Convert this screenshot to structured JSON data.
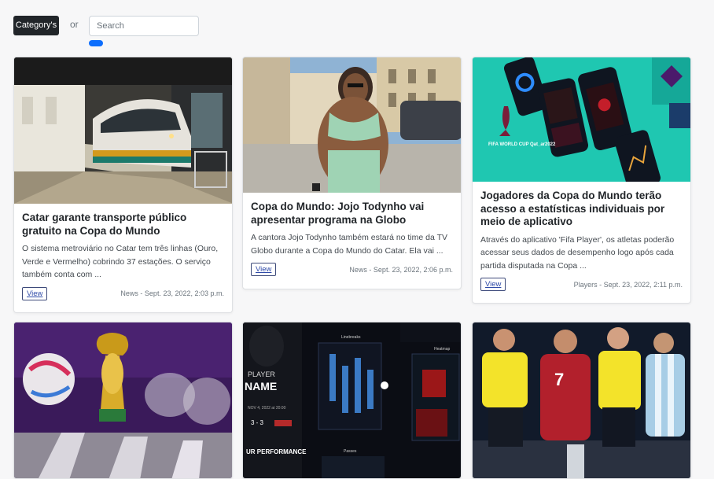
{
  "toolbar": {
    "category_label": "Category's",
    "or_label": "or",
    "search_placeholder": "Search"
  },
  "cards": [
    {
      "title": "Catar garante transporte público gratuito na Copa do Mundo",
      "excerpt": "O sistema metroviário no Catar tem três linhas (Ouro, Verde e Vermelho) cobrindo 37 estações. O serviço também conta com ...",
      "view_label": "View",
      "meta": "News - Sept. 23, 2022, 2:03 p.m.",
      "image": "metro-train-photo"
    },
    {
      "title": "Copa do Mundo: Jojo Todynho vai apresentar programa na Globo",
      "excerpt": "A cantora Jojo Todynho também estará no time da TV Globo durante a Copa do Mundo do Catar. Ela vai ...",
      "view_label": "View",
      "meta": "News - Sept. 23, 2022, 2:06 p.m.",
      "image": "street-portrait-photo"
    },
    {
      "title": "Jogadores da Copa do Mundo terão acesso a estatísticas individuais por meio de aplicativo",
      "excerpt": "Através do aplicativo 'Fifa Player', os atletas poderão acessar seus dados de desempenho logo após cada partida disputada na Copa ...",
      "view_label": "View",
      "meta": "Players - Sept. 23, 2022, 2:11 p.m.",
      "image": "fifa-app-phones-graphic"
    },
    {
      "image": "world-cup-trophy-photo"
    },
    {
      "image": "player-stats-dashboard"
    },
    {
      "image": "players-and-referees-photo"
    }
  ],
  "images": {
    "fifa_logo_text": "FIFA WORLD CUP Qat_ar2022",
    "dashboard_player": "PLAYER",
    "dashboard_name": "NAME",
    "dashboard_date": "NOV 4, 2022 at 20:00",
    "dashboard_score": "3 - 3",
    "dashboard_perf": "UR PERFORMANCE",
    "dashboard_linebreaks": "Linebreaks",
    "dashboard_heatmap": "Heatmap",
    "dashboard_passes": "Passes",
    "jersey_number": "7"
  },
  "colors": {
    "accent": "#0d6efd",
    "dark_button": "#212529",
    "app_teal": "#1fc7b1"
  }
}
